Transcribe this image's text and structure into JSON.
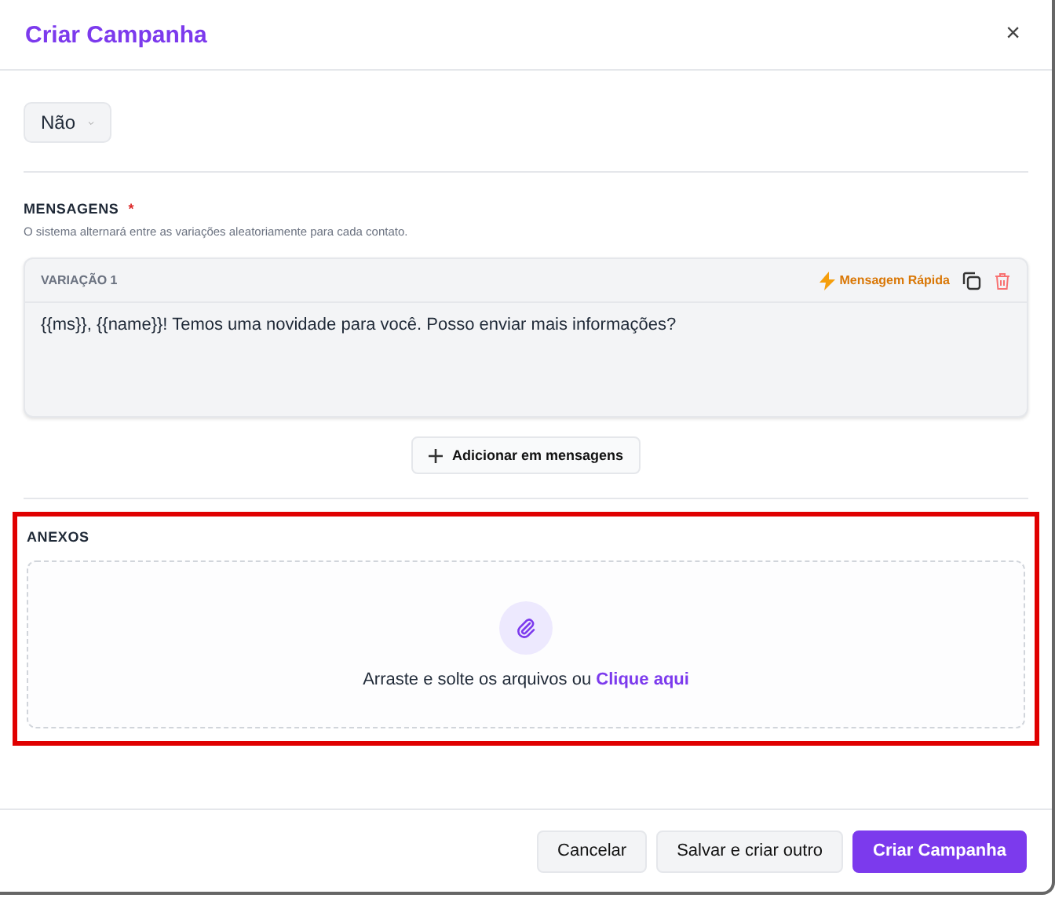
{
  "dialog": {
    "title": "Criar Campanha",
    "close": "×"
  },
  "select": {
    "value": "Não"
  },
  "messages": {
    "title": "MENSAGENS",
    "required": "*",
    "hint": "O sistema alternará entre as variações aleatoriamente para cada contato.",
    "variations": [
      {
        "label": "VARIAÇÃO 1",
        "quick": "Mensagem Rápida",
        "text": "{{ms}}, {{name}}! Temos uma novidade para você. Posso enviar mais informações?"
      }
    ],
    "add_button": "Adicionar em mensagens"
  },
  "attachments": {
    "title": "ANEXOS",
    "highlighted": true,
    "drop_text": "Arraste e solte os arquivos ou",
    "link": "Clique aqui"
  },
  "buttons": [
    {
      "label": "Cancelar",
      "kind": "secondary"
    },
    {
      "label": "Salvar e criar outro",
      "kind": "secondary"
    },
    {
      "label": "Criar Campanha",
      "kind": "primary"
    }
  ]
}
